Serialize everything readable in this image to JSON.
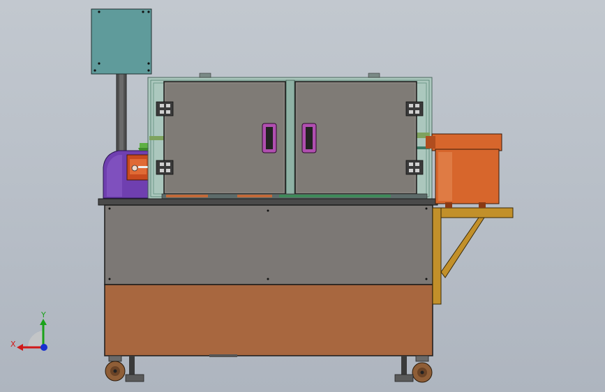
{
  "viewport": {
    "background_top": "#c2c8cf",
    "background_bottom": "#aeb5bf"
  },
  "model": {
    "components": [
      "control-box",
      "control-box-pole",
      "enclosure-frame",
      "left-door",
      "right-door",
      "door-handles",
      "hinges",
      "motor-assembly",
      "machine-base-panel",
      "lower-cabinet",
      "caster-wheels",
      "vibratory-feeder-bowl",
      "feeder-bracket"
    ],
    "colors": {
      "control_box": "#5f9b9b",
      "frame_glass": "#9fc7b8",
      "door_panel": "#7f7b76",
      "handle": "#b04fb0",
      "motor": "#6f3fb0",
      "motor_red": "#c84a1e",
      "base_panel": "#7c7875",
      "cabinet": "#a8673f",
      "feeder_bowl": "#d7662c",
      "bracket": "#c2902a",
      "caster": "#8f5e37"
    }
  },
  "triad": {
    "x_label": "X",
    "y_label": "Y",
    "x_color": "#d01818",
    "y_color": "#1aa21a",
    "z_color": "#1830d0"
  }
}
